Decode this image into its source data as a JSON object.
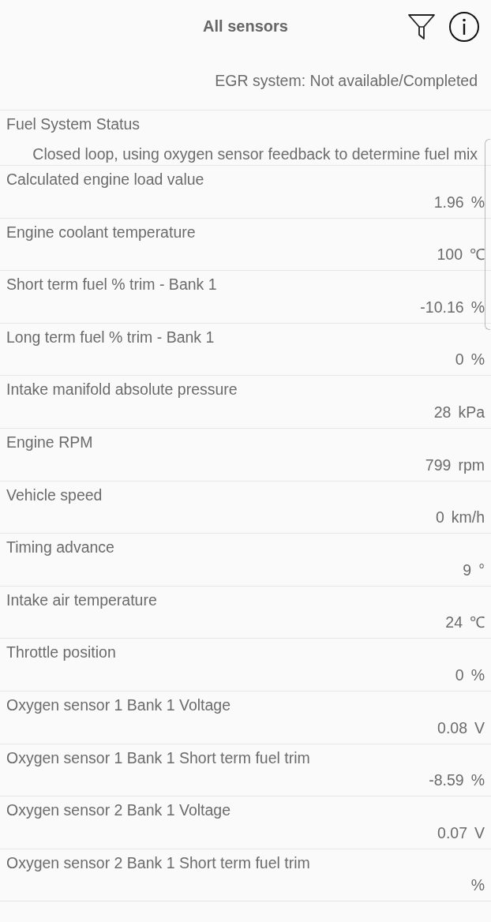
{
  "header": {
    "title": "All sensors"
  },
  "sensors": [
    {
      "kind": "text",
      "value": "EGR system: Not available/Completed"
    },
    {
      "kind": "text",
      "name": "Fuel System Status",
      "value": "Closed loop, using oxygen sensor feedback to determine fuel mix"
    },
    {
      "kind": "number",
      "name": "Calculated engine load value",
      "value": "1.96",
      "unit": "%"
    },
    {
      "kind": "number",
      "name": "Engine coolant temperature",
      "value": "100",
      "unit": "℃"
    },
    {
      "kind": "number",
      "name": "Short term fuel % trim - Bank 1",
      "value": "-10.16",
      "unit": "%"
    },
    {
      "kind": "number",
      "name": "Long term fuel % trim - Bank 1",
      "value": "0",
      "unit": "%"
    },
    {
      "kind": "number",
      "name": "Intake manifold absolute pressure",
      "value": "28",
      "unit": "kPa"
    },
    {
      "kind": "number",
      "name": "Engine RPM",
      "value": "799",
      "unit": "rpm"
    },
    {
      "kind": "number",
      "name": "Vehicle speed",
      "value": "0",
      "unit": "km/h"
    },
    {
      "kind": "number",
      "name": "Timing advance",
      "value": "9",
      "unit": "°"
    },
    {
      "kind": "number",
      "name": "Intake air temperature",
      "value": "24",
      "unit": "℃"
    },
    {
      "kind": "number",
      "name": "Throttle position",
      "value": "0",
      "unit": "%"
    },
    {
      "kind": "number",
      "name": "Oxygen sensor 1 Bank 1 Voltage",
      "value": "0.08",
      "unit": "V"
    },
    {
      "kind": "number",
      "name": "Oxygen sensor 1 Bank 1 Short term fuel trim",
      "value": "-8.59",
      "unit": "%"
    },
    {
      "kind": "number",
      "name": "Oxygen sensor 2 Bank 1 Voltage",
      "value": "0.07",
      "unit": "V"
    },
    {
      "kind": "number",
      "name": "Oxygen sensor 2 Bank 1 Short term fuel trim",
      "unit": "%"
    }
  ]
}
